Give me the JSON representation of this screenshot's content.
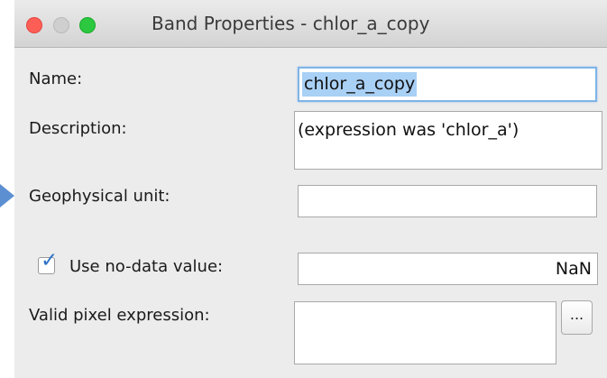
{
  "window": {
    "title": "Band Properties - chlor_a_copy"
  },
  "form": {
    "name_label": "Name:",
    "name_value": "chlor_a_copy",
    "description_label": "Description:",
    "description_value": "(expression was 'chlor_a')",
    "geophysical_unit_label": "Geophysical unit:",
    "geophysical_unit_value": "",
    "use_no_data_label": "Use no-data value:",
    "use_no_data_checked": true,
    "no_data_value": "NaN",
    "valid_pixel_label": "Valid pixel expression:",
    "valid_pixel_value": "",
    "ellipsis_label": "..."
  },
  "colors": {
    "selection": "#a9d0f5",
    "checkbox_accent": "#2d72c6",
    "close": "#fd5f57",
    "maximize": "#2cc840"
  }
}
